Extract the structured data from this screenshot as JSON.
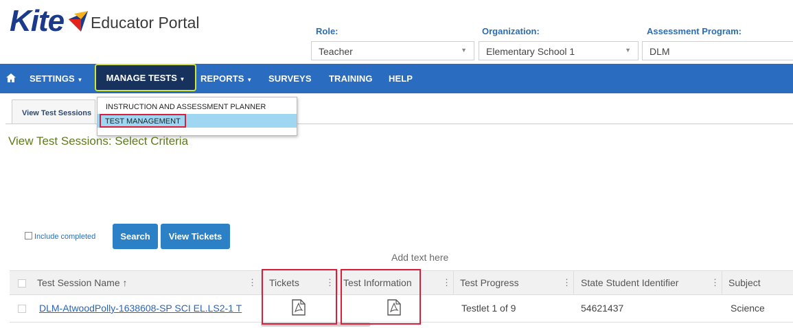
{
  "header": {
    "brand": "Kite",
    "portal_title": "Educator Portal",
    "role_label": "Role:",
    "role_value": "Teacher",
    "organization_label": "Organization:",
    "organization_value": "Elementary School 1",
    "program_label": "Assessment Program:",
    "program_value": "DLM"
  },
  "nav": {
    "settings": "SETTINGS",
    "manage_tests": "MANAGE TESTS",
    "reports": "REPORTS",
    "surveys": "SURVEYS",
    "training": "TRAINING",
    "help": "HELP"
  },
  "dropdown": {
    "items": [
      "INSTRUCTION AND ASSESSMENT PLANNER",
      "TEST MANAGEMENT"
    ]
  },
  "tab": {
    "label": "View Test Sessions"
  },
  "criteria_title": "View Test Sessions: Select Criteria",
  "controls": {
    "include_completed": "Include completed",
    "search": "Search",
    "view_tickets": "View Tickets",
    "add_text": "Add text here"
  },
  "table": {
    "columns": [
      "Test Session Name ↑",
      "Tickets",
      "Test Information",
      "Test Progress",
      "State Student Identifier",
      "Subject"
    ],
    "rows": [
      {
        "test_session_name": "DLM-AtwoodPolly-1638608-SP SCI EL.LS2-1 T",
        "test_progress": "Testlet 1 of 9",
        "state_student_identifier": "54621437",
        "subject": "Science"
      }
    ]
  },
  "colors": {
    "nav_bg": "#2a6cc0",
    "nav_active": "#17325c",
    "highlight_red": "#d71e3a",
    "criteria_green": "#5e7a1a"
  }
}
